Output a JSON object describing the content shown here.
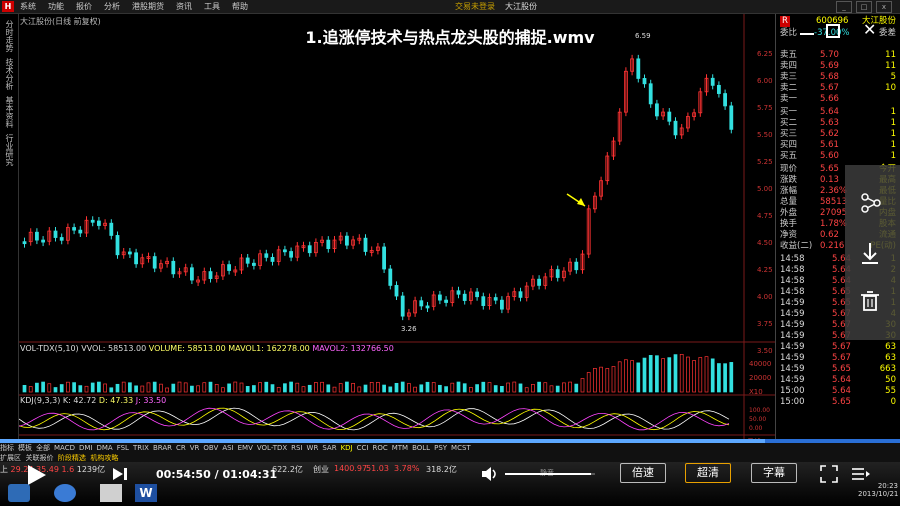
{
  "menubar": {
    "logo": "H",
    "items": [
      "系统",
      "功能",
      "报价",
      "分析",
      "港股期货",
      "资讯",
      "工具",
      "帮助"
    ],
    "center": [
      "交易未登录",
      "大江股份"
    ]
  },
  "vtabs": [
    "分时走势",
    "技术分析",
    "基本资料",
    "行业研究"
  ],
  "chart": {
    "title": "大江股份(日线 前复权)",
    "high_label": "6.59",
    "low_label": "3.26",
    "y_ticks": [
      "6.25",
      "6.00",
      "5.75",
      "5.50",
      "5.25",
      "5.00",
      "4.75",
      "4.50",
      "4.25",
      "4.00",
      "3.75",
      "3.50"
    ],
    "vol_ticks": [
      "40000",
      "20000",
      "X10"
    ],
    "kdj_ticks": [
      "100.00",
      "50.00",
      "0.00"
    ],
    "date_ticks": [
      "2013/",
      "2",
      "3",
      "4",
      "5",
      "6",
      "7",
      "8",
      "9",
      "10",
      "日线"
    ],
    "indicator": {
      "name": "VOL-TDX(5,10)",
      "vvol": "VVOL: 58513.00",
      "volume": "VOLUME: 58513.00",
      "mavol1": "MAVOL1: 162278.00",
      "mavol2": "MAVOL2: 132766.50"
    },
    "kdj": {
      "name": "KDJ(9,3,3)",
      "k": "K: 42.72",
      "d": "D: 47.33",
      "j": "J: 33.50"
    }
  },
  "video_title": "1.追涨停技术与热点龙头股的捕捉.wmv",
  "orderbook": {
    "code": "600696",
    "name": "大江股份",
    "header_left": "委比",
    "header_val": "-37.00%",
    "header_right": "委差",
    "asks": [
      {
        "label": "卖五",
        "price": "5.70",
        "vol": "11"
      },
      {
        "label": "卖四",
        "price": "5.69",
        "vol": "11"
      },
      {
        "label": "卖三",
        "price": "5.68",
        "vol": "5"
      },
      {
        "label": "卖二",
        "price": "5.67",
        "vol": "10"
      },
      {
        "label": "卖一",
        "price": "5.66",
        "vol": ""
      }
    ],
    "bids": [
      {
        "label": "买一",
        "price": "5.64",
        "vol": "1"
      },
      {
        "label": "买二",
        "price": "5.63",
        "vol": "1"
      },
      {
        "label": "买三",
        "price": "5.62",
        "vol": "1"
      },
      {
        "label": "买四",
        "price": "5.61",
        "vol": "1"
      },
      {
        "label": "买五",
        "price": "5.60",
        "vol": "1"
      }
    ],
    "stats": [
      {
        "label": "现价",
        "val": "5.65",
        "extra": "今开"
      },
      {
        "label": "涨跌",
        "val": "0.13",
        "extra": "最高"
      },
      {
        "label": "涨幅",
        "val": "2.36%",
        "extra": "最低"
      },
      {
        "label": "总量",
        "val": "58513",
        "extra": "量比"
      },
      {
        "label": "外盘",
        "val": "27095",
        "extra": "内盘"
      },
      {
        "label": "换手",
        "val": "1.78%",
        "extra": "股本"
      },
      {
        "label": "净资",
        "val": "0.62",
        "extra": "流通"
      },
      {
        "label": "收益(二)",
        "val": "0.216",
        "extra": "PE(动)"
      }
    ],
    "ticks": [
      {
        "time": "14:58",
        "price": "5.64",
        "vol": "1"
      },
      {
        "time": "14:58",
        "price": "5.64",
        "vol": "2"
      },
      {
        "time": "14:58",
        "price": "5.64",
        "vol": "4"
      },
      {
        "time": "14:58",
        "price": "5.65",
        "vol": "1"
      },
      {
        "time": "14:59",
        "price": "5.65",
        "vol": "1"
      },
      {
        "time": "14:59",
        "price": "5.67",
        "vol": "4"
      },
      {
        "time": "14:59",
        "price": "5.67",
        "vol": "30"
      },
      {
        "time": "14:59",
        "price": "5.67",
        "vol": "30"
      },
      {
        "time": "14:59",
        "price": "5.67",
        "vol": "63"
      },
      {
        "time": "14:59",
        "price": "5.67",
        "vol": "63"
      },
      {
        "time": "14:59",
        "price": "5.65",
        "vol": "663"
      },
      {
        "time": "14:59",
        "price": "5.64",
        "vol": "50"
      },
      {
        "time": "15:00",
        "price": "5.64",
        "vol": "55"
      },
      {
        "time": "15:00",
        "price": "5.65",
        "vol": "0"
      }
    ]
  },
  "bottom_tabs": [
    "指标",
    "模板",
    "全部",
    "MACD",
    "DMI",
    "DMA",
    "FSL",
    "TRIX",
    "BRAR",
    "CR",
    "VR",
    "OBV",
    "ASI",
    "EMV",
    "VOL-TDX",
    "RSI",
    "WR",
    "SAR",
    "KDJ",
    "CCI",
    "ROC",
    "MTM",
    "BOLL",
    "PSY",
    "MCST"
  ],
  "status_row": [
    "扩展区",
    "关联报价",
    "阶段精选",
    "机构攻略"
  ],
  "index_strip": {
    "sh_label": "上",
    "sh_val": "29.24",
    "v1": "35.49",
    "v2": "1.6",
    "v3": "1239亿",
    "v4": "622.2亿",
    "v5": "创业",
    "v6": "1400.97",
    "v7": "51.03",
    "v8": "3.78%",
    "v9": "318.2亿"
  },
  "player": {
    "time_current": "00:54:50",
    "time_separator": "/",
    "time_total": "01:04:31",
    "volume_label": "静音",
    "speed_button": "倍速",
    "quality_button": "超清",
    "subtitle_button": "字幕",
    "progress_fraction": 0.85,
    "volume_fraction": 0.95,
    "clock_time": "20:23",
    "clock_date": "2013/10/21"
  },
  "overlay": {
    "close": "✕",
    "buttons": [
      "share-icon",
      "download-icon",
      "delete-icon"
    ]
  },
  "colors": {
    "up": "#ff3333",
    "down": "#33e0e0",
    "accent": "#ffff00"
  }
}
